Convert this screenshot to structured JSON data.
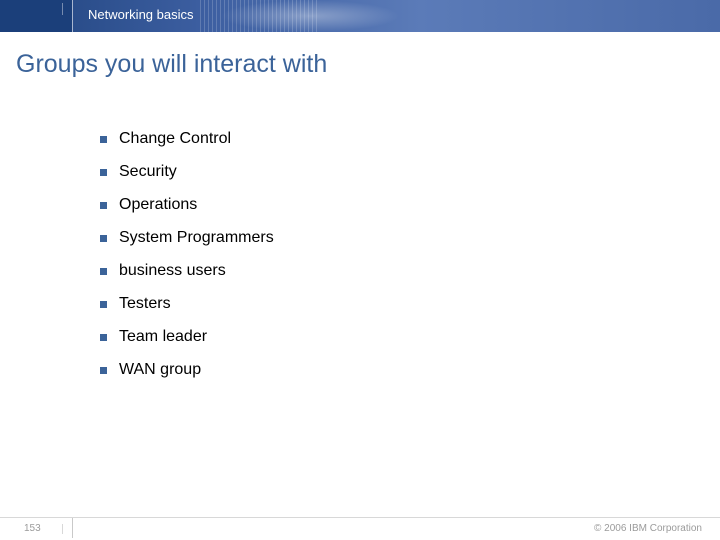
{
  "header": {
    "title": "Networking basics"
  },
  "slide": {
    "title": "Groups you will interact with",
    "bullets": [
      "Change Control",
      "Security",
      "Operations",
      "System Programmers",
      "business users",
      "Testers",
      "Team leader",
      " WAN group"
    ]
  },
  "footer": {
    "page": "153",
    "copyright": "© 2006 IBM Corporation"
  }
}
